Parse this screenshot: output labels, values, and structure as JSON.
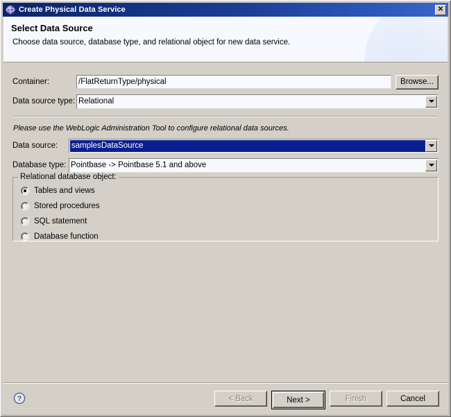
{
  "window": {
    "title": "Create Physical Data Service",
    "icon": "globe-icon",
    "close_label": "✕"
  },
  "header": {
    "title": "Select Data Source",
    "subtitle": "Choose data source, database type, and relational object for new data service."
  },
  "form": {
    "container": {
      "label": "Container:",
      "value": "/FlatReturnType/physical",
      "browse_label": "Browse..."
    },
    "data_source_type": {
      "label": "Data source type:",
      "value": "Relational"
    },
    "note": "Please use the WebLogic Administration Tool to configure relational data sources.",
    "data_source": {
      "label": "Data source:",
      "value": "samplesDataSource"
    },
    "database_type": {
      "label": "Database type:",
      "value": "Pointbase -> Pointbase 5.1 and above"
    }
  },
  "relational_object_group": {
    "title": "Relational database object:",
    "options": [
      {
        "label": "Tables and views",
        "checked": true
      },
      {
        "label": "Stored procedures",
        "checked": false
      },
      {
        "label": "SQL statement",
        "checked": false
      },
      {
        "label": "Database function",
        "checked": false
      }
    ]
  },
  "footer": {
    "help_icon": "help-circle-icon",
    "buttons": [
      {
        "label": "< Back",
        "enabled": false,
        "default": false
      },
      {
        "label": "Next >",
        "enabled": true,
        "default": true
      },
      {
        "label": "Finish",
        "enabled": false,
        "default": false
      },
      {
        "label": "Cancel",
        "enabled": true,
        "default": false
      }
    ]
  },
  "colors": {
    "titlebar_start": "#0a246a",
    "titlebar_end": "#3a66cc",
    "dialog_face": "#d4d0c8",
    "field_bg": "#f7f9ff",
    "selection": "#0a1f8f",
    "header_bg": "#f7f9fe",
    "disabled_text": "#868379"
  }
}
